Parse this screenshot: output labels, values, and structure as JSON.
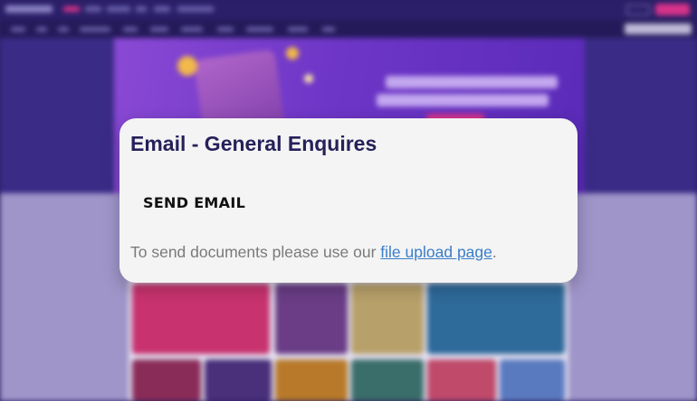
{
  "modal": {
    "title": "Email - General Enquires",
    "send_email_label": "SEND EMAIL",
    "note_prefix": "To send documents please use our ",
    "note_link": "file upload page",
    "note_suffix": "."
  },
  "icons": [
    "coin-icon"
  ],
  "colors": {
    "brand_purple": "#2b1f69",
    "accent_pink": "#d8338a",
    "modal_bg": "#f4f4f4",
    "title_color": "#26215a",
    "link_color": "#3a7ec9"
  }
}
